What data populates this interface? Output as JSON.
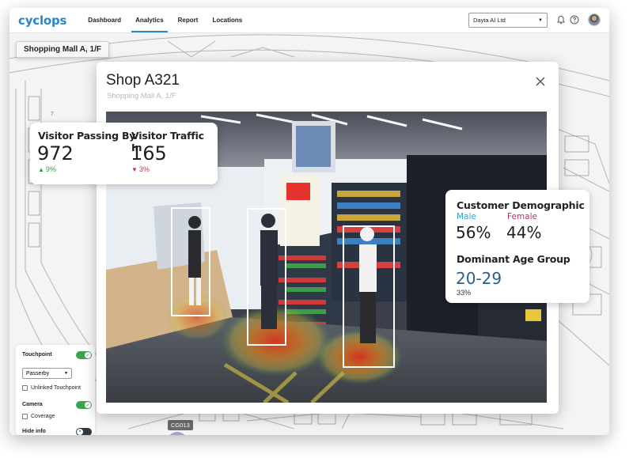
{
  "app": {
    "logo": "cyclops",
    "nav": [
      "Dashboard",
      "Analytics",
      "Report",
      "Locations"
    ],
    "active_nav": "Analytics",
    "organization": "Dayta AI Ltd",
    "accent_color": "#2a86c7"
  },
  "floorplan": {
    "location": "Shopping Mall A, 1/F",
    "marker_label": "CG013"
  },
  "controls": {
    "touchpoint_label": "Touchpoint",
    "touchpoint_select": "Passerby",
    "unlinked_label": "Unlinked Touchpoint",
    "camera_label": "Camera",
    "coverage_label": "Coverage",
    "hide_info_label": "Hide info"
  },
  "shop": {
    "title": "Shop A321",
    "subtitle": "Shopping Mall A, 1/F"
  },
  "traffic": {
    "passing_label": "Visitor Passing By",
    "passing_value": "972",
    "passing_delta": "9%",
    "in_label": "Visitor Traffic In",
    "in_value": "165",
    "in_delta": "3%",
    "up_color": "#2e9e46",
    "down_color": "#c9344b"
  },
  "demographic": {
    "title": "Customer Demographic",
    "male_label": "Male",
    "female_label": "Female",
    "male_value": "56%",
    "female_value": "44%",
    "male_color": "#2aa7c9",
    "female_color": "#c2306a",
    "age_title": "Dominant Age Group",
    "age_value": "20-29",
    "age_pct": "33%",
    "age_color": "#2b5f8a"
  }
}
